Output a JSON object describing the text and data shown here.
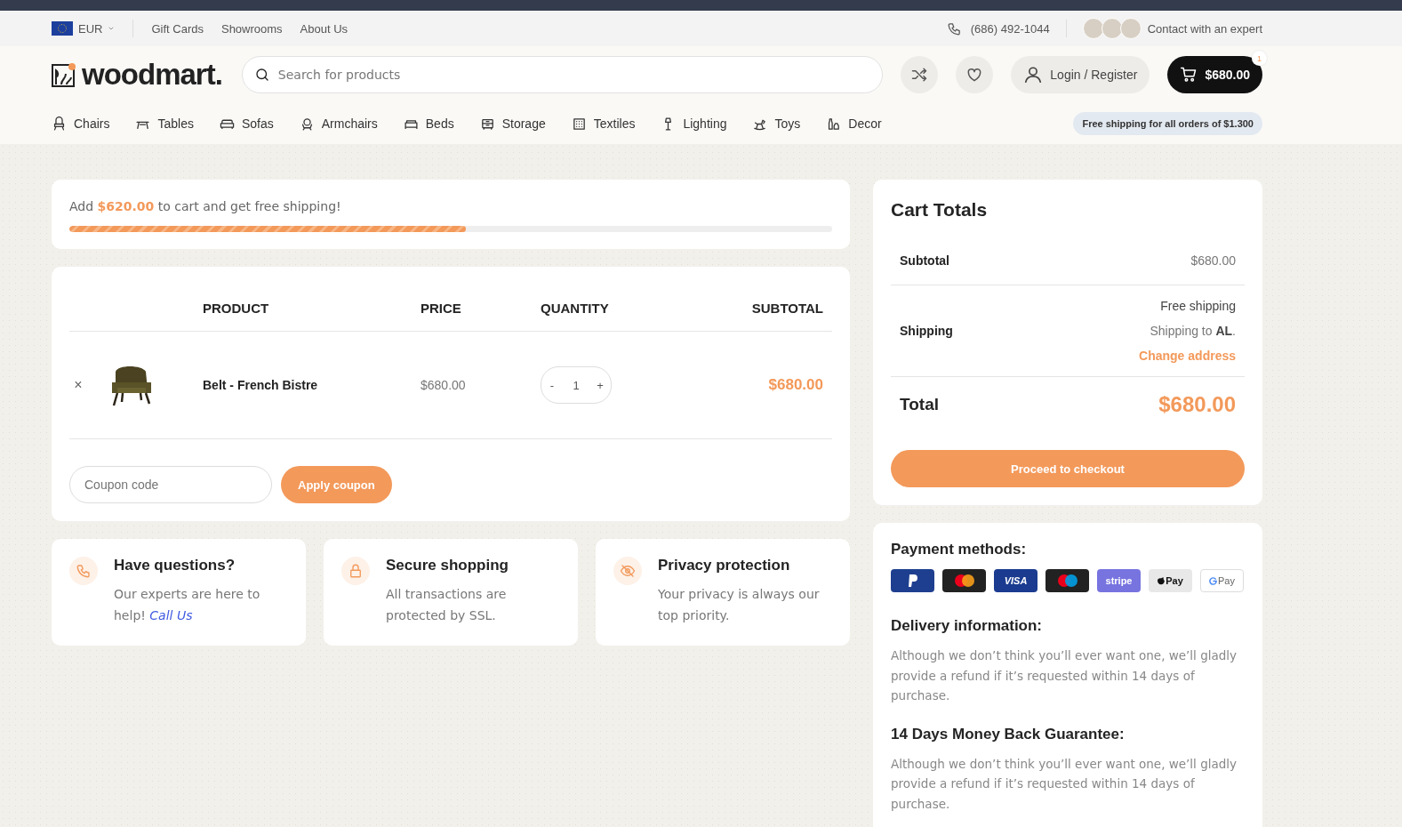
{
  "topbar": {
    "currency": "EUR",
    "links": [
      "Gift Cards",
      "Showrooms",
      "About Us"
    ],
    "phone": "(686) 492-1044",
    "contact": "Contact with an expert"
  },
  "header": {
    "logo": "woodmart.",
    "search": {
      "placeholder": "Search for products"
    },
    "login": "Login / Register",
    "cart_total": "$680.00",
    "cart_count": "1"
  },
  "nav": {
    "items": [
      "Chairs",
      "Tables",
      "Sofas",
      "Armchairs",
      "Beds",
      "Storage",
      "Textiles",
      "Lighting",
      "Toys",
      "Decor"
    ],
    "promo": "Free shipping for all orders of $1.300"
  },
  "shipping_progress": {
    "message": "Add **$620.00** to cart and get free shipping!",
    "level": 0.52
  },
  "cart_table": {
    "columns": [
      "PRODUCT",
      "PRICE",
      "QUANTITY",
      "SUBTOTAL"
    ],
    "rows": [
      {
        "product": "Belt - French Bistre",
        "price": "$680.00",
        "quantity": "1",
        "subtotal": "$680.00"
      }
    ],
    "remove": "×",
    "quantity_minus": "-",
    "quantity_plus": "+",
    "coupon": {
      "placeholder": "Coupon code",
      "button": "Apply coupon"
    }
  },
  "features": [
    {
      "title": "Have questions?",
      "text": "Our experts are here to help! ",
      "link": "Call Us"
    },
    {
      "title": "Secure shopping",
      "text": "All transactions are protected by SSL."
    },
    {
      "title": "Privacy protection",
      "text": "Your privacy is always our top priority."
    }
  ],
  "cart_totals": {
    "title": "Cart Totals",
    "subtotal_label": "Subtotal",
    "subtotal": "$680.00",
    "shipping_label": "Shipping",
    "shipping_method": "Free shipping",
    "shipping_to": "Shipping to **AL**.",
    "change_address": "Change address",
    "total_label": "Total",
    "total": "$680.00",
    "checkout": "Proceed to checkout"
  },
  "info": {
    "payment_title": "Payment methods:",
    "payment_methods": [
      {
        "kind": "paypal"
      },
      {
        "kind": "mastercard"
      },
      {
        "kind": "visa",
        "label": "VISA"
      },
      {
        "kind": "maestro"
      },
      {
        "kind": "stripe",
        "label": "stripe"
      },
      {
        "kind": "applepay",
        "label": "Pay"
      },
      {
        "kind": "gpay",
        "label": "Pay"
      }
    ],
    "sections": [
      {
        "title": "Delivery information:",
        "text": "Although we don’t think you’ll ever want one, we’ll gladly provide a refund if it’s requested within 14 days of purchase."
      },
      {
        "title": "14 Days Money Back Guarantee:",
        "text": "Although we don’t think you’ll ever want one, we’ll gladly provide a refund if it’s requested within 14 days of purchase."
      }
    ]
  }
}
